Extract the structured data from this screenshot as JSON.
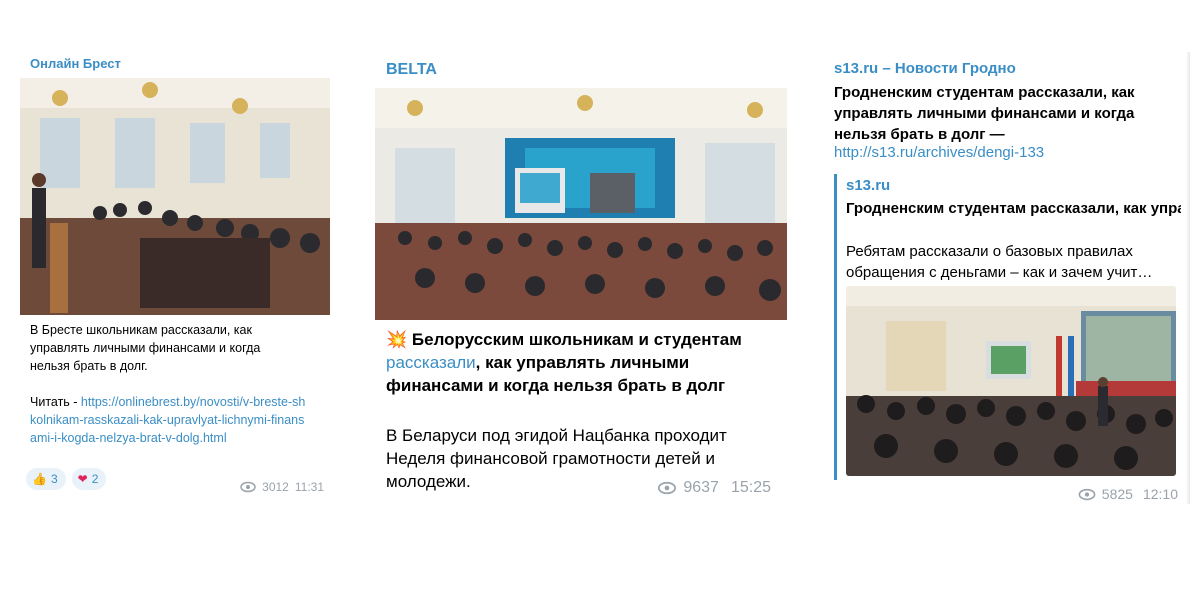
{
  "card1": {
    "channel": "Онлайн Брест",
    "text_lines": [
      "В Бресте школьникам рассказали, как",
      "управлять личными финансами и когда",
      "нельзя брать в долг."
    ],
    "read_label": "Читать - ",
    "read_url": "https://onlinebrest.by/novosti/v-breste-shkolnikam-rasskazali-kak-upravlyat-lichnymi-finansami-i-kogda-nelzya-brat-v-dolg.html",
    "reactions": [
      {
        "emoji": "👍",
        "count": "3"
      },
      {
        "emoji": "❤",
        "count": "2"
      }
    ],
    "views": "3012",
    "time": "11:31"
  },
  "card2": {
    "channel": "BELTA",
    "headline_emoji": "💥",
    "headline_part1": "Белорусским школьникам и студентам ",
    "headline_link": "рассказали",
    "headline_part2": ", как управлять личными финансами и когда нельзя брать в долг",
    "body": "В Беларуси под эгидой Нацбанка проходит Неделя финансовой грамотности детей и молодежи.",
    "views": "9637",
    "time": "15:25"
  },
  "card3": {
    "channel": "s13.ru – Новости Гродно",
    "title": "Гродненским студентам рассказали, как управлять личными финансами и когда нельзя брать в долг —",
    "url": "http://s13.ru/archives/dengi-133",
    "preview": {
      "site": "s13.ru",
      "title": "Гродненским студентам рассказали, как управлять личными финансами и когда …",
      "desc_line1": "Ребятам рассказали о базовых правилах",
      "desc_line2": "обращения с деньгами – как и зачем учит…"
    },
    "views": "5825",
    "time": "12:10"
  },
  "colors": {
    "accent": "#3a8ec5",
    "meta": "#9aa3ab",
    "reaction_bg": "#e9f2f9"
  },
  "icons": [
    "eye-icon",
    "thumbs-up-icon",
    "heart-icon",
    "explosion-icon"
  ]
}
